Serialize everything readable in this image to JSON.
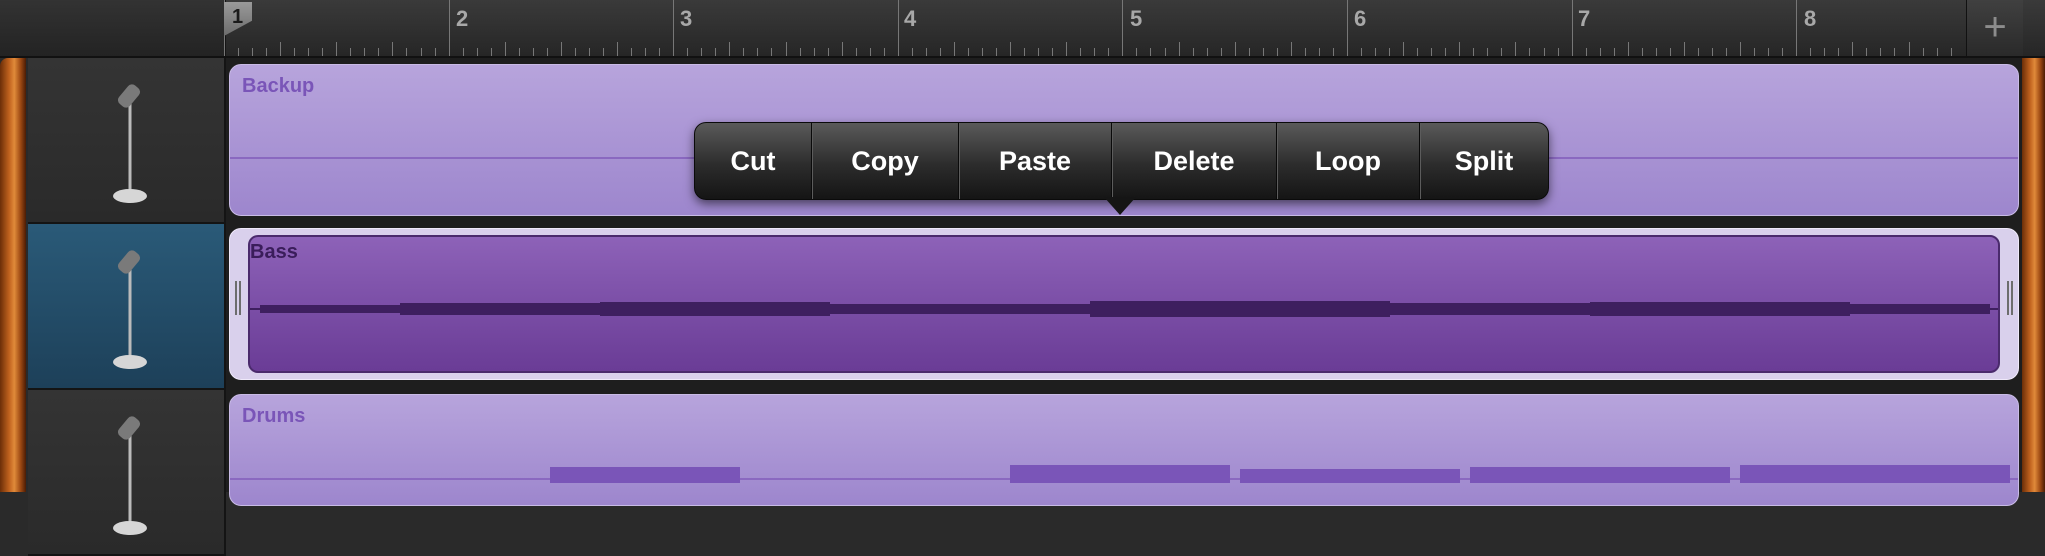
{
  "ruler": {
    "bars": [
      "2",
      "3",
      "4",
      "5",
      "6",
      "7",
      "8"
    ],
    "playhead_label": "1",
    "add_icon": "plus-icon"
  },
  "tracks": [
    {
      "name": "Backup",
      "instrument_icon": "microphone-icon",
      "selected": false
    },
    {
      "name": "Bass",
      "instrument_icon": "microphone-icon",
      "selected": true
    },
    {
      "name": "Drums",
      "instrument_icon": "microphone-icon",
      "selected": false
    }
  ],
  "context_menu": {
    "items": [
      "Cut",
      "Copy",
      "Paste",
      "Delete",
      "Loop",
      "Split"
    ]
  },
  "colors": {
    "region": "#b09bd8",
    "region_selected": "#7a4ea8",
    "selected_track_header": "#24506b",
    "wood": "#c0621e"
  }
}
